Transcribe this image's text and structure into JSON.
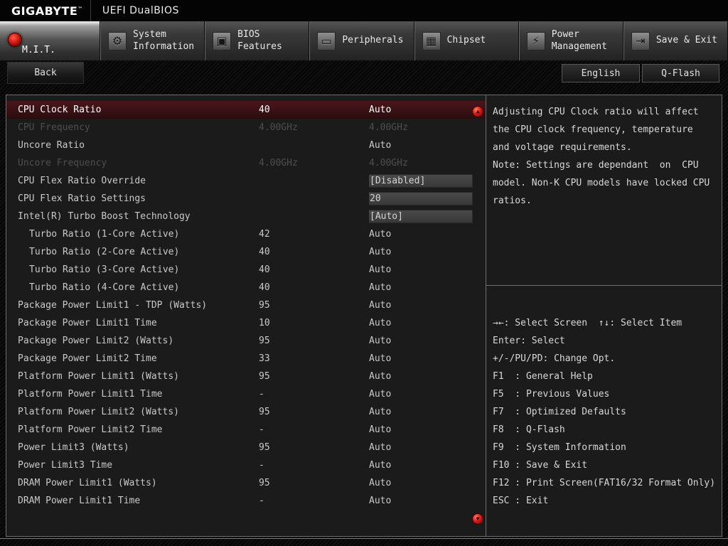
{
  "header": {
    "brand": "GIGABYTE",
    "trademark": "™",
    "title": "UEFI DualBIOS"
  },
  "toolbar": {
    "back_label": "Back",
    "language_label": "English",
    "qflash_label": "Q-Flash"
  },
  "accent_colors": {
    "selected_row": "#3f1317",
    "scroll_indicator": "#d01510",
    "active_tab_dot": "#d31a10"
  },
  "tabs": [
    {
      "name": "mit",
      "label": "M.I.T.",
      "icon": "mit-red-dot-icon",
      "glyph": "",
      "active": true
    },
    {
      "name": "system-information",
      "label": "System Information",
      "icon": "gear-icon",
      "glyph": "⚙",
      "active": false
    },
    {
      "name": "bios-features",
      "label": "BIOS Features",
      "icon": "bios-icon",
      "glyph": "▣",
      "active": false
    },
    {
      "name": "peripherals",
      "label": "Peripherals",
      "icon": "peripherals-monitor-icon",
      "glyph": "▭",
      "active": false
    },
    {
      "name": "chipset",
      "label": "Chipset",
      "icon": "chipset-icon",
      "glyph": "▦",
      "active": false
    },
    {
      "name": "power-management",
      "label": "Power Management",
      "icon": "power-icon",
      "glyph": "⚡",
      "active": false
    },
    {
      "name": "save-exit",
      "label": "Save & Exit",
      "icon": "save-exit-icon",
      "glyph": "⇥",
      "active": false
    }
  ],
  "settings": {
    "rows": [
      {
        "label": "CPU Clock Ratio",
        "value": "40",
        "option": "Auto",
        "state": "selected"
      },
      {
        "label": "CPU Frequency",
        "value": "4.00GHz",
        "option": "4.00GHz",
        "state": "disabled"
      },
      {
        "label": "Uncore Ratio",
        "value": "",
        "option": "Auto"
      },
      {
        "label": "Uncore Frequency",
        "value": "4.00GHz",
        "option": "4.00GHz",
        "state": "disabled"
      },
      {
        "label": "CPU Flex Ratio Override",
        "value": "",
        "option": "[Disabled]",
        "boxed": true
      },
      {
        "label": "CPU Flex Ratio Settings",
        "value": "",
        "option": "20",
        "boxed": true
      },
      {
        "label": "Intel(R) Turbo Boost Technology",
        "value": "",
        "option": "[Auto]",
        "boxed": true
      },
      {
        "label": "Turbo Ratio (1-Core Active)",
        "value": "42",
        "option": "Auto",
        "indent": true
      },
      {
        "label": "Turbo Ratio (2-Core Active)",
        "value": "40",
        "option": "Auto",
        "indent": true
      },
      {
        "label": "Turbo Ratio (3-Core Active)",
        "value": "40",
        "option": "Auto",
        "indent": true
      },
      {
        "label": "Turbo Ratio (4-Core Active)",
        "value": "40",
        "option": "Auto",
        "indent": true
      },
      {
        "label": "Package Power Limit1 - TDP (Watts)",
        "value": "95",
        "option": "Auto"
      },
      {
        "label": "Package Power Limit1 Time",
        "value": "10",
        "option": "Auto"
      },
      {
        "label": "Package Power Limit2 (Watts)",
        "value": "95",
        "option": "Auto"
      },
      {
        "label": "Package Power Limit2 Time",
        "value": "33",
        "option": "Auto"
      },
      {
        "label": "Platform Power Limit1 (Watts)",
        "value": "95",
        "option": "Auto"
      },
      {
        "label": "Platform Power Limit1 Time",
        "value": "-",
        "option": "Auto"
      },
      {
        "label": "Platform Power Limit2 (Watts)",
        "value": "95",
        "option": "Auto"
      },
      {
        "label": "Platform Power Limit2 Time",
        "value": "-",
        "option": "Auto"
      },
      {
        "label": "Power Limit3 (Watts)",
        "value": "95",
        "option": "Auto"
      },
      {
        "label": "Power Limit3 Time",
        "value": "-",
        "option": "Auto"
      },
      {
        "label": "DRAM Power Limit1 (Watts)",
        "value": "95",
        "option": "Auto"
      },
      {
        "label": "DRAM Power Limit1 Time",
        "value": "-",
        "option": "Auto"
      }
    ]
  },
  "scroll": {
    "up": "▲",
    "down": "▼"
  },
  "help": {
    "description_lines": [
      "Adjusting CPU Clock ratio will affect",
      "the CPU clock frequency, temperature",
      "and voltage requirements.",
      "Note: Settings are dependant  on  CPU",
      "model. Non-K CPU models have locked CPU",
      "ratios."
    ],
    "key_lines": [
      "→←: Select Screen  ↑↓: Select Item",
      "Enter: Select",
      "+/-/PU/PD: Change Opt.",
      "F1  : General Help",
      "F5  : Previous Values",
      "F7  : Optimized Defaults",
      "F8  : Q-Flash",
      "F9  : System Information",
      "F10 : Save & Exit",
      "F12 : Print Screen(FAT16/32 Format Only)",
      "ESC : Exit"
    ]
  }
}
